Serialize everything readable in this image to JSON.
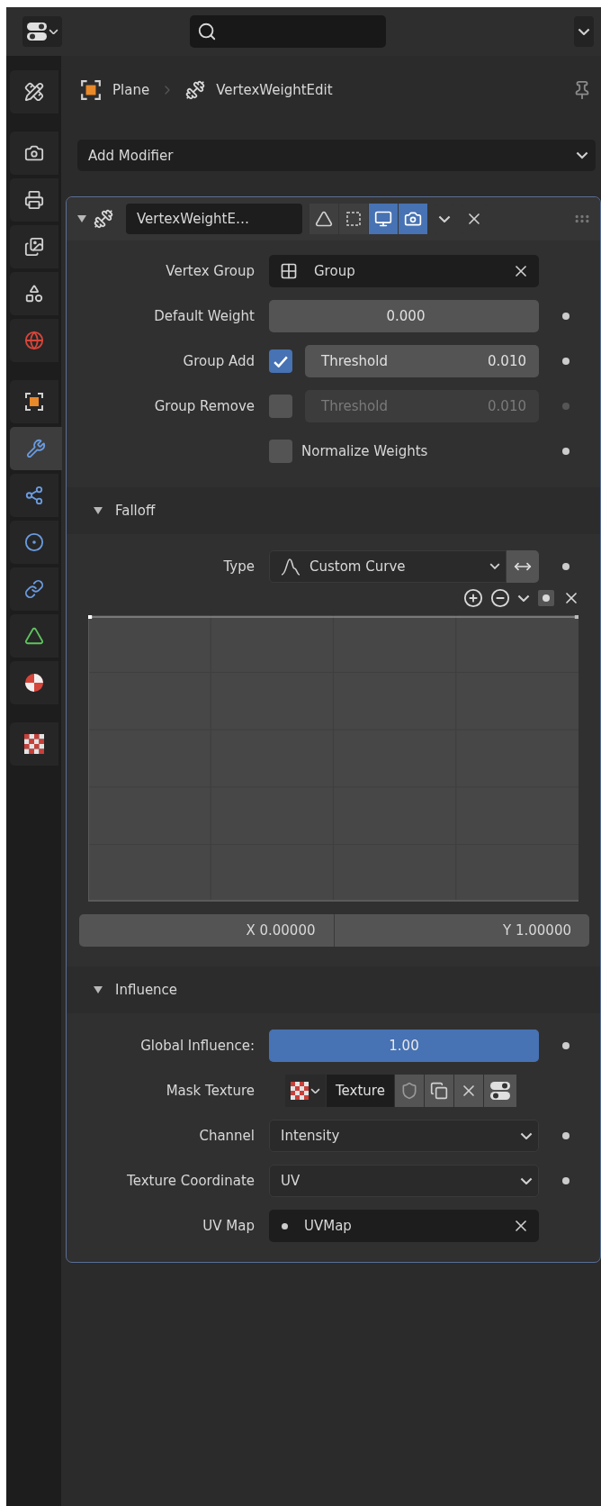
{
  "sidebar": {
    "groups": [
      {
        "tabs": [
          {
            "kind": "tool",
            "selected": false
          }
        ]
      },
      {
        "tabs": [
          {
            "kind": "render",
            "selected": false
          },
          {
            "kind": "output",
            "selected": false
          },
          {
            "kind": "view_layer",
            "selected": false
          },
          {
            "kind": "scene",
            "selected": false
          },
          {
            "kind": "world",
            "selected": false
          }
        ]
      },
      {
        "tabs": [
          {
            "kind": "object",
            "selected": false
          },
          {
            "kind": "modifiers",
            "selected": true
          },
          {
            "kind": "particles",
            "selected": false
          },
          {
            "kind": "physics",
            "selected": false
          },
          {
            "kind": "constraints",
            "selected": false
          },
          {
            "kind": "data",
            "selected": false
          },
          {
            "kind": "material",
            "selected": false
          }
        ]
      },
      {
        "tabs": [
          {
            "kind": "texture",
            "selected": false
          }
        ]
      }
    ]
  },
  "breadcrumb": {
    "object": "Plane",
    "modifier": "VertexWeightEdit"
  },
  "add_modifier": {
    "label": "Add Modifier"
  },
  "modifier": {
    "name": "VertexWeightE…",
    "expanded": true,
    "toggles": [
      {
        "kind": "edit_mode",
        "on": false
      },
      {
        "kind": "on_cage",
        "on": false
      },
      {
        "kind": "viewport",
        "on": true
      },
      {
        "kind": "render",
        "on": true
      }
    ],
    "rows": [
      {
        "kind": "group_search",
        "label": "Vertex Group",
        "value": "Group"
      },
      {
        "kind": "number",
        "label": "Default Weight",
        "value": "0.000",
        "keyframe": true
      },
      {
        "kind": "check_number",
        "label": "Group Add",
        "checked": true,
        "field_label": "Threshold",
        "value": "0.010",
        "keyframe": true
      },
      {
        "kind": "check_number",
        "label": "Group Remove",
        "checked": false,
        "field_label": "Threshold",
        "value": "0.010",
        "keyframe": true
      },
      {
        "kind": "checkbox",
        "text": "Normalize Weights",
        "checked": false,
        "keyframe": true
      }
    ],
    "falloff": {
      "title": "Falloff",
      "expanded": true,
      "type_label": "Type",
      "type_value": "Custom Curve",
      "invert_on": false,
      "keyframe": true,
      "x_reading": "X 0.00000",
      "y_reading": "Y 1.00000"
    },
    "influence": {
      "title": "Influence",
      "expanded": true,
      "rows": [
        {
          "kind": "slider",
          "label": "Global Influence:",
          "value": "1.00",
          "level": 1,
          "keyframe": true
        },
        {
          "kind": "texture",
          "label": "Mask Texture",
          "value": "Texture"
        },
        {
          "kind": "dropdown",
          "label": "Channel",
          "value": "Intensity",
          "keyframe": true
        },
        {
          "kind": "dropdown",
          "label": "Texture Coordinate",
          "value": "UV",
          "keyframe": true
        },
        {
          "kind": "map_search",
          "label": "UV Map",
          "value": "UVMap"
        }
      ]
    }
  }
}
